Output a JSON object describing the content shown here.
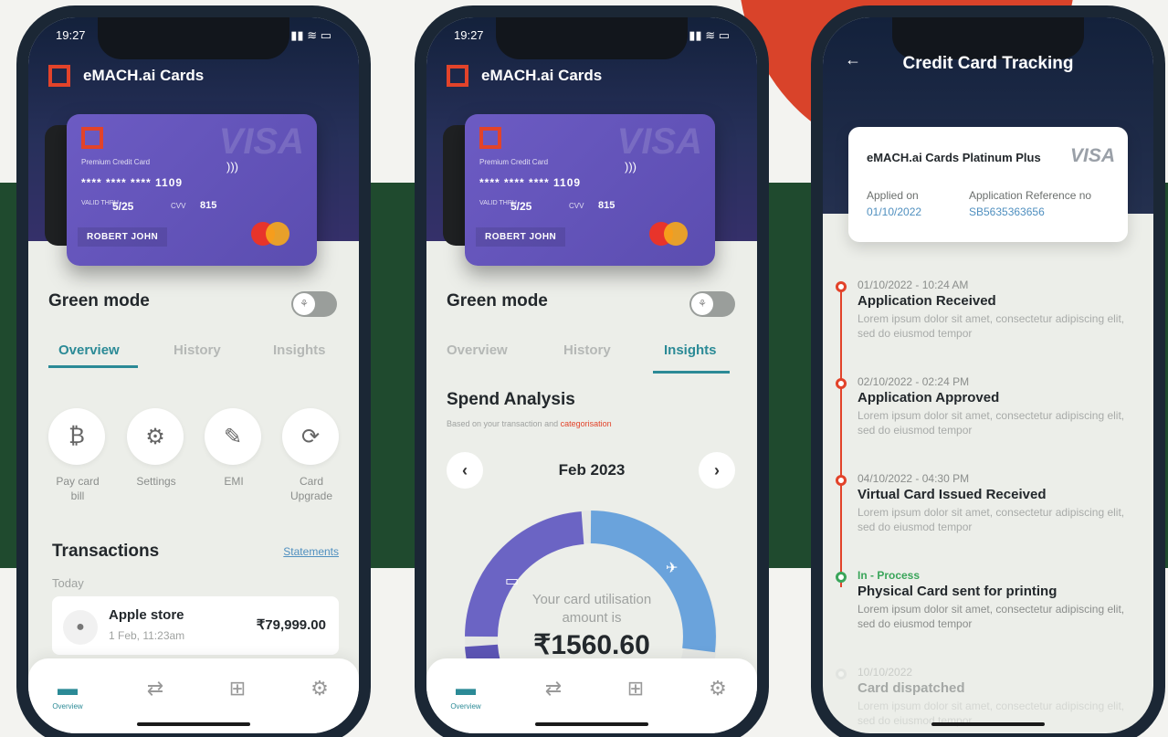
{
  "colors": {
    "accent": "#2b8a96",
    "brand_red": "#e2432a",
    "band_green": "#1f4a2e",
    "card_purple": "#5b4db0"
  },
  "time": "19:27",
  "brand": "eMACH.ai Cards",
  "card": {
    "label": "Premium Credit Card",
    "number": "**** **** **** 1109",
    "valid_label": "VALID THRU",
    "expiry": "5/25",
    "cvv_label": "CVV",
    "cvv": "815",
    "holder": "ROBERT JOHN",
    "network_watermark": "VISA"
  },
  "green_mode": "Green mode",
  "tabs": [
    "Overview",
    "History",
    "Insights"
  ],
  "quick_actions": [
    {
      "label": "Pay card bill",
      "icon": "bill-icon"
    },
    {
      "label": "Settings",
      "icon": "gear-icon"
    },
    {
      "label": "EMI",
      "icon": "emi-icon"
    },
    {
      "label": "Card Upgrade",
      "icon": "card-upgrade-icon"
    }
  ],
  "transactions": {
    "title": "Transactions",
    "statements": "Statements",
    "group": "Today",
    "items": [
      {
        "merchant": "Apple store",
        "date": "1 Feb, 11:23am",
        "amount": "₹79,999.00"
      }
    ]
  },
  "nav": {
    "overview": "Overview"
  },
  "insights": {
    "title": "Spend Analysis",
    "subtitle": "Based on your transaction and",
    "subtitle_highlight": "categorisation",
    "month": "Feb 2023",
    "utilisation_label": "Your card utilisation amount is",
    "utilisation_value": "₹1560.60"
  },
  "tracking": {
    "title": "Credit Card Tracking",
    "card_name": "eMACH.ai Cards Platinum Plus",
    "network": "VISA",
    "applied_label": "Applied on",
    "applied_value": "01/10/2022",
    "ref_label": "Application Reference no",
    "ref_value": "SB5635363656",
    "events": [
      {
        "date": "01/10/2022 - 10:24 AM",
        "title": "Application Received",
        "body": "Lorem ipsum dolor sit amet, consectetur adipiscing elit, sed do eiusmod tempor"
      },
      {
        "date": "02/10/2022 - 02:24 PM",
        "title": "Application Approved",
        "body": "Lorem ipsum dolor sit amet, consectetur adipiscing elit, sed do eiusmod tempor"
      },
      {
        "date": "04/10/2022 - 04:30 PM",
        "title": "Virtual Card Issued Received",
        "body": "Lorem ipsum dolor sit amet, consectetur adipiscing elit, sed do eiusmod tempor"
      },
      {
        "date": "In - Process",
        "title": "Physical Card sent for printing",
        "body": "Lorem ipsum dolor sit amet, consectetur adipiscing elit, sed do eiusmod tempor"
      },
      {
        "date": "10/10/2022",
        "title": "Card dispatched",
        "body": "Lorem ipsum dolor sit amet, consectetur adipiscing elit, sed do eiusmod tempor"
      }
    ]
  }
}
